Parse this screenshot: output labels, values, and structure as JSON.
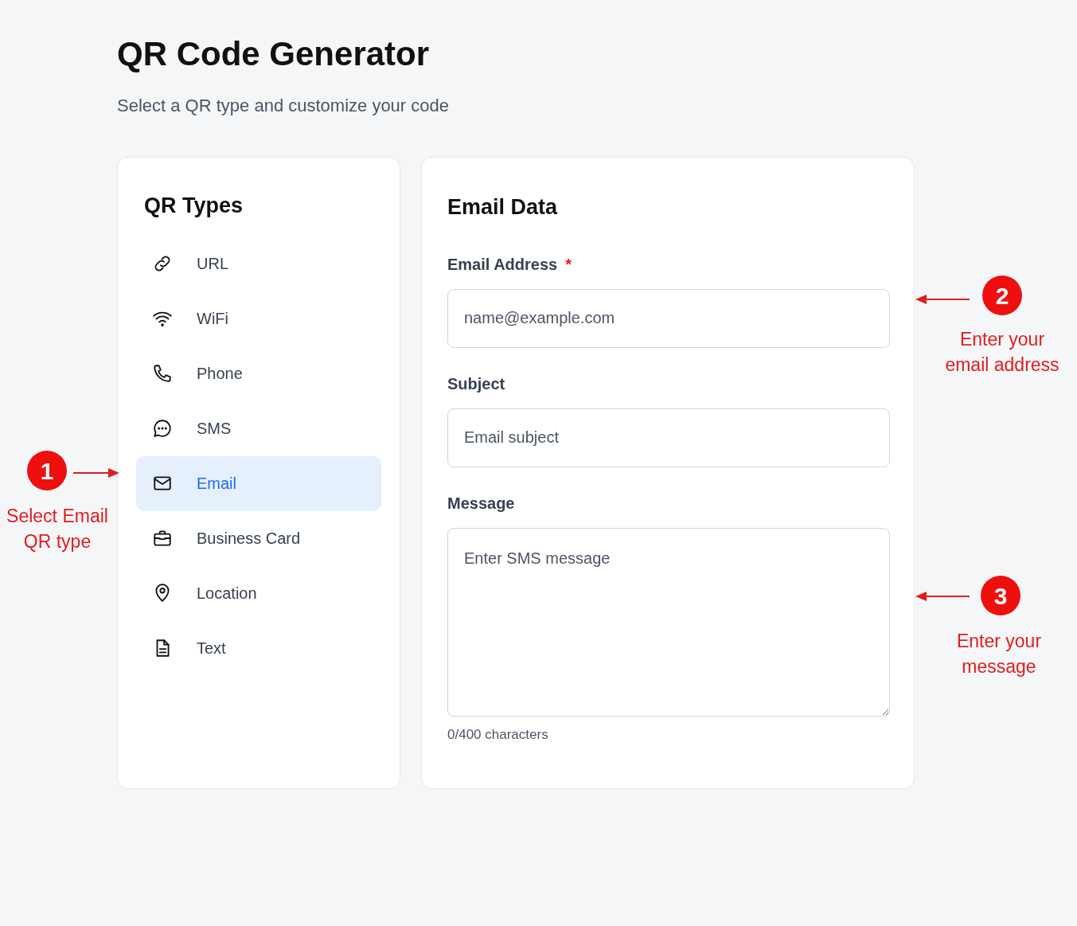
{
  "header": {
    "title": "QR Code Generator",
    "subtitle": "Select a QR type and customize your code"
  },
  "sidebar": {
    "title": "QR Types",
    "items": [
      {
        "label": "URL",
        "kind": "link",
        "selected": false
      },
      {
        "label": "WiFi",
        "kind": "wifi",
        "selected": false
      },
      {
        "label": "Phone",
        "kind": "phone",
        "selected": false
      },
      {
        "label": "SMS",
        "kind": "chat",
        "selected": false
      },
      {
        "label": "Email",
        "kind": "mail",
        "selected": true
      },
      {
        "label": "Business Card",
        "kind": "briefcase",
        "selected": false
      },
      {
        "label": "Location",
        "kind": "pin",
        "selected": false
      },
      {
        "label": "Text",
        "kind": "file",
        "selected": false
      }
    ]
  },
  "form": {
    "title": "Email Data",
    "fields": [
      {
        "label": "Email Address",
        "required_mark": "*",
        "kind": "input",
        "placeholder": "name@example.com"
      },
      {
        "label": "Subject",
        "kind": "input",
        "placeholder": "Email subject"
      },
      {
        "label": "Message",
        "kind": "textarea",
        "placeholder": "Enter SMS message",
        "counter": "0/400 characters"
      }
    ]
  },
  "annotations": [
    {
      "number": "1",
      "text": "Select Email QR type",
      "kind": "arrow-right"
    },
    {
      "number": "2",
      "text": "Enter your email address",
      "kind": "arrow-left"
    },
    {
      "number": "3",
      "text": "Enter your message",
      "kind": "arrow-left"
    }
  ]
}
